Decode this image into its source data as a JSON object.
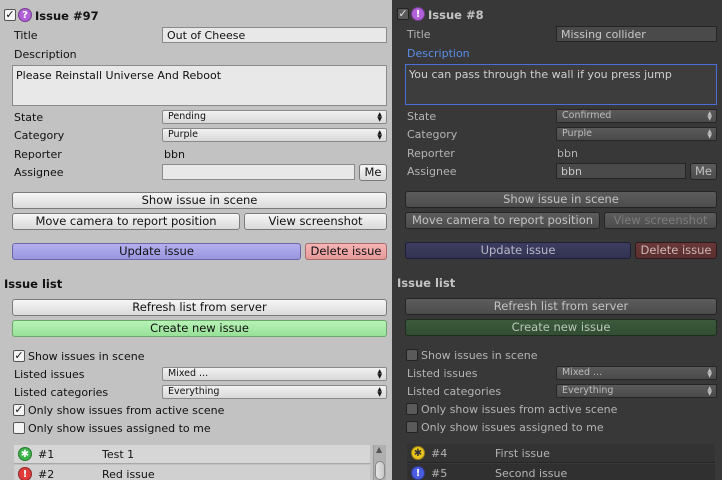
{
  "colors": {
    "light_bg": "#c2c2c2",
    "dark_bg": "#383838",
    "update": "#a8a4e8",
    "delete": "#ee9f9f",
    "create": "#a6ea a6",
    "focus": "#4a6fd6"
  },
  "light": {
    "issue_header": "Issue #97",
    "issue_checked": true,
    "labels": {
      "title": "Title",
      "description": "Description",
      "state": "State",
      "category": "Category",
      "reporter": "Reporter",
      "assignee": "Assignee"
    },
    "title_value": "Out of Cheese",
    "description_value": "Please Reinstall Universe And Reboot",
    "state_value": "Pending",
    "category_value": "Purple",
    "reporter_value": "bbn",
    "assignee_value": "",
    "me_label": "Me",
    "show_issue_label": "Show issue in scene",
    "move_camera_label": "Move camera to report position",
    "view_screenshot_label": "View screenshot",
    "update_label": "Update issue",
    "delete_label": "Delete issue",
    "issue_list_header": "Issue list",
    "refresh_label": "Refresh list from server",
    "create_label": "Create new issue",
    "show_issues_label": "Show issues in scene",
    "show_issues_checked": true,
    "listed_issues_label": "Listed issues",
    "listed_issues_value": "Mixed ...",
    "listed_categories_label": "Listed categories",
    "listed_categories_value": "Everything",
    "only_active_label": "Only show issues from active scene",
    "only_active_checked": true,
    "only_assigned_label": "Only show issues assigned to me",
    "only_assigned_checked": false,
    "rows": [
      {
        "num": "#1",
        "title": "Test 1",
        "icon": "star-icon",
        "color": "#3cb54a"
      },
      {
        "num": "#2",
        "title": "Red issue",
        "icon": "exclamation-icon",
        "color": "#e03a3a"
      }
    ]
  },
  "dark": {
    "issue_header": "Issue #8",
    "issue_checked": true,
    "labels": {
      "title": "Title",
      "description": "Description",
      "state": "State",
      "category": "Category",
      "reporter": "Reporter",
      "assignee": "Assignee"
    },
    "title_value": "Missing collider",
    "description_value": "You can pass through the wall if you press jump",
    "state_value": "Confirmed",
    "category_value": "Purple",
    "reporter_value": "bbn",
    "assignee_value": "bbn",
    "me_label": "Me",
    "show_issue_label": "Show issue in scene",
    "move_camera_label": "Move camera to report position",
    "view_screenshot_label": "View screenshot",
    "update_label": "Update issue",
    "delete_label": "Delete issue",
    "issue_list_header": "Issue list",
    "refresh_label": "Refresh list from server",
    "create_label": "Create new issue",
    "show_issues_label": "Show issues in scene",
    "show_issues_checked": false,
    "listed_issues_label": "Listed issues",
    "listed_issues_value": "Mixed ...",
    "listed_categories_label": "Listed categories",
    "listed_categories_value": "Everything",
    "only_active_label": "Only show issues from active scene",
    "only_active_checked": false,
    "only_assigned_label": "Only show issues assigned to me",
    "only_assigned_checked": false,
    "rows": [
      {
        "num": "#4",
        "title": "First issue",
        "icon": "star-icon",
        "color": "#e8c21e"
      },
      {
        "num": "#5",
        "title": "Second issue",
        "icon": "exclamation-icon",
        "color": "#4a5ce0"
      }
    ]
  }
}
